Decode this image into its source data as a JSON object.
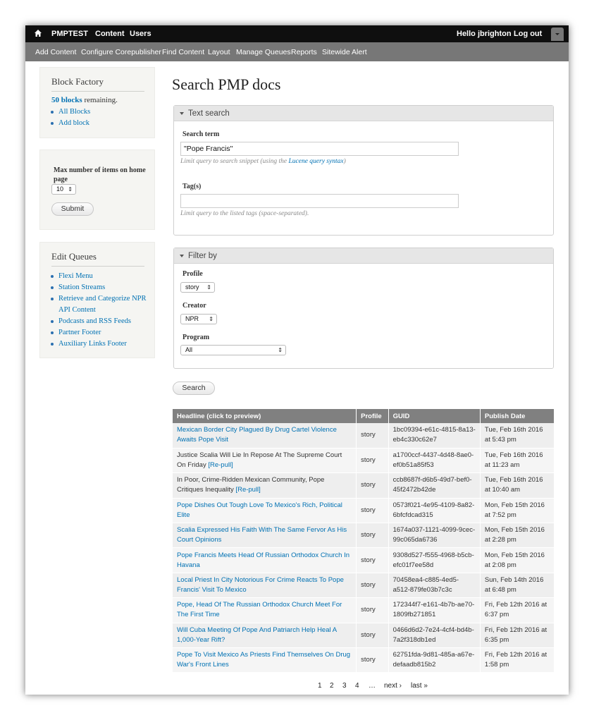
{
  "toolbar": {
    "site": "PMPTEST",
    "content": "Content",
    "users": "Users",
    "hello": "Hello jbrighton",
    "logout": "Log out"
  },
  "shortcuts": [
    "Add Content",
    "Configure Corepublisher",
    "Find Content",
    "Layout",
    "Manage Queues",
    "Reports",
    "Sitewide Alert"
  ],
  "block_factory": {
    "title": "Block Factory",
    "count": "50 blocks",
    "remaining": " remaining.",
    "links": [
      "All Blocks",
      "Add block"
    ]
  },
  "home_form": {
    "label": "Max number of items on home page",
    "value": "10",
    "submit": "Submit"
  },
  "edit_queues": {
    "title": "Edit Queues",
    "links": [
      "Flexi Menu",
      "Station Streams",
      "Retrieve and Categorize NPR API Content",
      "Podcasts and RSS Feeds",
      "Partner Footer",
      "Auxiliary Links Footer"
    ]
  },
  "main": {
    "title": "Search PMP docs",
    "text_search": {
      "legend": "Text search",
      "term_label": "Search term",
      "term_value": "\"Pope Francis\"",
      "term_desc_pre": "Limit query to search snippet (using the ",
      "term_desc_link": "Lucene query syntax",
      "term_desc_post": ")",
      "tags_label": "Tag(s)",
      "tags_value": "",
      "tags_desc": "Limit query to the listed tags (space-separated)."
    },
    "filter": {
      "legend": "Filter by",
      "profile_label": "Profile",
      "profile_value": "story",
      "creator_label": "Creator",
      "creator_value": "NPR",
      "program_label": "Program",
      "program_value": "All"
    },
    "search_button": "Search"
  },
  "table": {
    "headers": [
      "Headline (click to preview)",
      "Profile",
      "GUID",
      "Publish Date"
    ],
    "rows": [
      {
        "headline": "Mexican Border City Plagued By Drug Cartel Violence Awaits Pope Visit",
        "repull": "",
        "profile": "story",
        "guid": "1bc09394-e61c-4815-8a13-eb4c330c62e7",
        "date": "Tue, Feb 16th 2016 at 5:43 pm"
      },
      {
        "headline": "Justice Scalia Will Lie In Repose At The Supreme Court On Friday",
        "repull": "[Re-pull]",
        "profile": "story",
        "guid": "a1700ccf-4437-4d48-8ae0-ef0b51a85f53",
        "date": "Tue, Feb 16th 2016 at 11:23 am"
      },
      {
        "headline": "In Poor, Crime-Ridden Mexican Community, Pope Critiques Inequality",
        "repull": "[Re-pull]",
        "profile": "story",
        "guid": "ccb8687f-d6b5-49d7-bef0-45f2472b42de",
        "date": "Tue, Feb 16th 2016 at 10:40 am"
      },
      {
        "headline": "Pope Dishes Out Tough Love To Mexico's Rich, Political Elite",
        "repull": "",
        "profile": "story",
        "guid": "0573f021-4e95-4109-8a82-6bfcfdcad315",
        "date": "Mon, Feb 15th 2016 at 7:52 pm"
      },
      {
        "headline": "Scalia Expressed His Faith With The Same Fervor As His Court Opinions",
        "repull": "",
        "profile": "story",
        "guid": "1674a037-1121-4099-9cec-99c065da6736",
        "date": "Mon, Feb 15th 2016 at 2:28 pm"
      },
      {
        "headline": "Pope Francis Meets Head Of Russian Orthodox Church In Havana",
        "repull": "",
        "profile": "story",
        "guid": "9308d527-f555-4968-b5cb-efc01f7ee58d",
        "date": "Mon, Feb 15th 2016 at 2:08 pm"
      },
      {
        "headline": "Local Priest In City Notorious For Crime Reacts To Pope Francis' Visit To Mexico",
        "repull": "",
        "profile": "story",
        "guid": "70458ea4-c885-4ed5-a512-879fe03b7c3c",
        "date": "Sun, Feb 14th 2016 at 6:48 pm"
      },
      {
        "headline": "Pope, Head Of The Russian Orthodox Church Meet For The First Time",
        "repull": "",
        "profile": "story",
        "guid": "172344f7-e161-4b7b-ae70-1809fb271851",
        "date": "Fri, Feb 12th 2016 at 6:37 pm"
      },
      {
        "headline": "Will Cuba Meeting Of Pope And Patriarch Help Heal A 1,000-Year Rift?",
        "repull": "",
        "profile": "story",
        "guid": "0466d6d2-7e24-4cf4-bd4b-7a2f318db1ed",
        "date": "Fri, Feb 12th 2016 at 6:35 pm"
      },
      {
        "headline": "Pope To Visit Mexico As Priests Find Themselves On Drug War's Front Lines",
        "repull": "",
        "profile": "story",
        "guid": "62751fda-9d81-485a-a67e-defaadb815b2",
        "date": "Fri, Feb 12th 2016 at 1:58 pm"
      }
    ]
  },
  "pager": {
    "pages": [
      "1",
      "2",
      "3",
      "4"
    ],
    "ellipsis": "…",
    "next": "next ›",
    "last": "last »"
  },
  "colors": {
    "link": "#0071b3",
    "toolbar_dark": "#0f0f0f",
    "toolbar_shortcuts": "#777777",
    "table_header": "#808080"
  }
}
